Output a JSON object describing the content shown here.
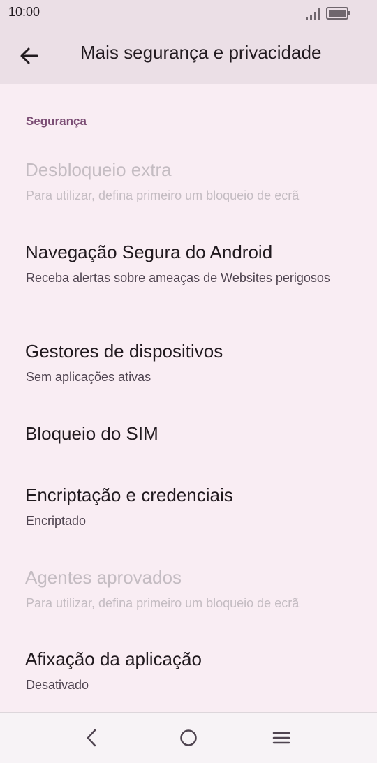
{
  "status_bar": {
    "time": "10:00"
  },
  "app_bar": {
    "title": "Mais segurança e privacidade"
  },
  "section": {
    "header": "Segurança"
  },
  "items": [
    {
      "title": "Desbloqueio extra",
      "summary": "Para utilizar, defina primeiro um bloqueio de ecrã",
      "enabled": false
    },
    {
      "title": "Navegação Segura do Android",
      "summary": "Receba alertas sobre ameaças de Websites perigosos",
      "enabled": true
    },
    {
      "title": "Gestores de dispositivos",
      "summary": "Sem aplicações ativas",
      "enabled": true
    },
    {
      "title": "Bloqueio do SIM",
      "summary": "",
      "enabled": true
    },
    {
      "title": "Encriptação e credenciais",
      "summary": "Encriptado",
      "enabled": true
    },
    {
      "title": "Agentes aprovados",
      "summary": "Para utilizar, defina primeiro um bloqueio de ecrã",
      "enabled": false
    },
    {
      "title": "Afixação da aplicação",
      "summary": "Desativado",
      "enabled": true
    }
  ],
  "colors": {
    "background": "#f9edf3",
    "app_bar": "#ebdfe6",
    "accent": "#7b4d74",
    "disabled_text": "#c4bcc2"
  },
  "icons": {
    "back": "arrow-back-icon",
    "signal": "signal-icon",
    "battery": "battery-icon",
    "nav_back": "nav-back-icon",
    "nav_home": "nav-home-icon",
    "nav_recents": "nav-menu-icon"
  }
}
